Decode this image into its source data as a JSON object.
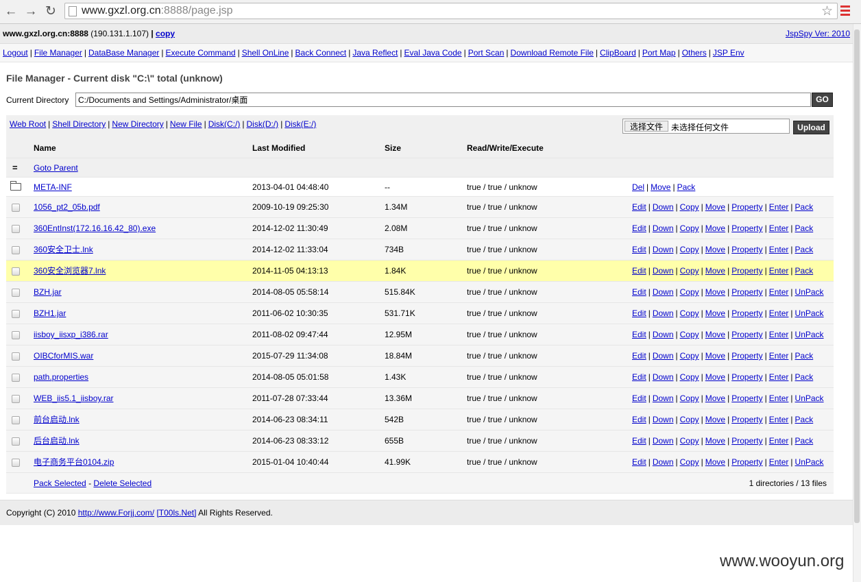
{
  "browser": {
    "url_host": "www.gxzl.org.cn",
    "url_rest": ":8888/page.jsp",
    "back": "←",
    "forward": "→",
    "reload": "↻",
    "star": "☆"
  },
  "header": {
    "host": "www.gxzl.org.cn:8888",
    "ip": "(190.131.1.107)",
    "sep": "|",
    "copy": "copy",
    "version": "JspSpy Ver: 2010"
  },
  "menu": [
    "Logout",
    "File Manager",
    "DataBase Manager",
    "Execute Command",
    "Shell OnLine",
    "Back Connect",
    "Java Reflect",
    "Eval Java Code",
    "Port Scan",
    "Download Remote File",
    "ClipBoard",
    "Port Map",
    "Others",
    "JSP Env"
  ],
  "page": {
    "title": "File Manager - Current disk \"C:\\\" total (unknow)",
    "current_dir_label": "Current Directory",
    "current_dir_value": "C:/Documents and Settings/Administrator/桌面",
    "go": "GO"
  },
  "toolbar": {
    "links": [
      "Web Root",
      "Shell Directory",
      "New Directory",
      "New File",
      "Disk(C:/)",
      "Disk(D:/)",
      "Disk(E:/)"
    ],
    "choose_file": "选择文件",
    "no_file": "未选择任何文件",
    "upload": "Upload"
  },
  "table": {
    "headers": {
      "name": "Name",
      "modified": "Last Modified",
      "size": "Size",
      "rwx": "Read/Write/Execute"
    },
    "parent_icon": "=",
    "parent": "Goto Parent",
    "dir": {
      "name": "META-INF",
      "modified": "2013-04-01 04:48:40",
      "size": "--",
      "rwx": "true / true / unknow",
      "actions": [
        "Del",
        "Move",
        "Pack"
      ]
    },
    "files": [
      {
        "name": "1056_pt2_05b.pdf",
        "modified": "2009-10-19 09:25:30",
        "size": "1.34M",
        "rwx": "true / true / unknow",
        "last": "Pack"
      },
      {
        "name": "360EntInst(172.16.16.42_80).exe",
        "modified": "2014-12-02 11:30:49",
        "size": "2.08M",
        "rwx": "true / true / unknow",
        "last": "Pack"
      },
      {
        "name": "360安全卫士.lnk",
        "modified": "2014-12-02 11:33:04",
        "size": "734B",
        "rwx": "true / true / unknow",
        "last": "Pack"
      },
      {
        "name": "360安全浏览器7.lnk",
        "modified": "2014-11-05 04:13:13",
        "size": "1.84K",
        "rwx": "true / true / unknow",
        "last": "Pack"
      },
      {
        "name": "BZH.jar",
        "modified": "2014-08-05 05:58:14",
        "size": "515.84K",
        "rwx": "true / true / unknow",
        "last": "UnPack"
      },
      {
        "name": "BZH1.jar",
        "modified": "2011-06-02 10:30:35",
        "size": "531.71K",
        "rwx": "true / true / unknow",
        "last": "UnPack"
      },
      {
        "name": "iisboy_iisxp_i386.rar",
        "modified": "2011-08-02 09:47:44",
        "size": "12.95M",
        "rwx": "true / true / unknow",
        "last": "UnPack"
      },
      {
        "name": "OIBCforMIS.war",
        "modified": "2015-07-29 11:34:08",
        "size": "18.84M",
        "rwx": "true / true / unknow",
        "last": "Pack"
      },
      {
        "name": "path.properties",
        "modified": "2014-08-05 05:01:58",
        "size": "1.43K",
        "rwx": "true / true / unknow",
        "last": "Pack"
      },
      {
        "name": "WEB_iis5.1_iisboy.rar",
        "modified": "2011-07-28 07:33:44",
        "size": "13.36M",
        "rwx": "true / true / unknow",
        "last": "UnPack"
      },
      {
        "name": "前台启动.lnk",
        "modified": "2014-06-23 08:34:11",
        "size": "542B",
        "rwx": "true / true / unknow",
        "last": "Pack"
      },
      {
        "name": "后台启动.lnk",
        "modified": "2014-06-23 08:33:12",
        "size": "655B",
        "rwx": "true / true / unknow",
        "last": "Pack"
      },
      {
        "name": "电子商务平台0104.zip",
        "modified": "2015-01-04 10:40:44",
        "size": "41.99K",
        "rwx": "true / true / unknow",
        "last": "UnPack"
      }
    ],
    "file_actions": [
      "Edit",
      "Down",
      "Copy",
      "Move",
      "Property",
      "Enter"
    ],
    "highlight_index": 3,
    "pack_selected": "Pack Selected",
    "delete_selected": "Delete Selected",
    "dash": "-",
    "count": "1 directories / 13 files"
  },
  "footer": {
    "prefix": "Copyright (C) 2010",
    "link1": "http://www.Forjj.com/",
    "link2": "[T00ls.Net]",
    "suffix": "All Rights Reserved."
  },
  "watermark": "www.wooyun.org",
  "colors": {
    "link": "#0000cc",
    "highlight": "#ffffaa",
    "button": "#444444"
  }
}
